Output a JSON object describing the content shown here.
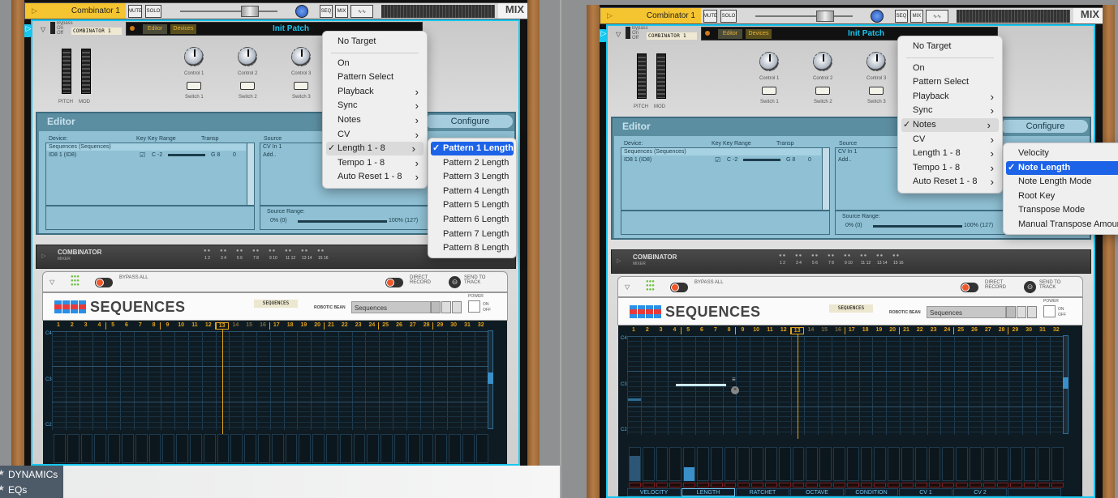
{
  "device": {
    "track_name": "Combinator 1",
    "mute": "MUTE",
    "solo": "SOLO",
    "seq": "SEQ",
    "mix": "MIX",
    "mix_label": "MIX",
    "bypass": "Bypass",
    "on": "On",
    "off": "Off",
    "combinator_label": "COMBINATOR 1",
    "editor_tab": "Editor",
    "devices_tab": "Devices",
    "patch_name": "Init Patch",
    "controls": [
      "Control 1",
      "Control 2",
      "Control 3"
    ],
    "switches": [
      "Switch 1",
      "Switch 2",
      "Switch 3"
    ],
    "pitch": "PITCH",
    "mod": "MOD",
    "editor_title": "Editor",
    "configure": "Configure",
    "col_device": "Device:",
    "col_key": "Key",
    "col_key_range": "Key Range",
    "col_transp": "Transp",
    "col_source": "Source",
    "rows": [
      {
        "name": "Sequences (Sequences)"
      },
      {
        "name": "ID8 1 (ID8)",
        "key_checked": true,
        "range_low": "C -2",
        "range_high": "G 8",
        "transp": "0"
      }
    ],
    "source_cv": "CV In 1",
    "source_add": "Add..",
    "source_range_label": "Source Range:",
    "range_min": "0% (0)",
    "range_max": "100% (127)",
    "mixer_title": "COMBINATOR",
    "mixer_sub": "MIXER",
    "mixer_channels": [
      "1 2",
      "3 4",
      "5 6",
      "7 8",
      "9 10",
      "11 12",
      "13 14",
      "15 16"
    ],
    "bypass_all": "BYPASS ALL",
    "direct_record": "DIRECT RECORD",
    "send_to_track": "SEND TO TRACK",
    "seq_title": "SEQUENCES",
    "seq_tag": "SEQUENCES",
    "brand": "ROBOTIC BEAN",
    "patch_field": "Sequences",
    "power": "POWER",
    "power_on": "ON",
    "power_off": "OFF",
    "steps": [
      "1",
      "2",
      "3",
      "4",
      "5",
      "6",
      "7",
      "8",
      "9",
      "10",
      "11",
      "12",
      "13",
      "14",
      "15",
      "16",
      "17",
      "18",
      "19",
      "20",
      "21",
      "22",
      "23",
      "24",
      "25",
      "26",
      "27",
      "28",
      "29",
      "30",
      "31",
      "32"
    ],
    "current_step": 13,
    "note_labels": [
      "C4",
      "C3",
      "C2"
    ],
    "lanes": [
      "VELOCITY",
      "LENGTH",
      "RATCHET",
      "OCTAVE",
      "CONDITION",
      "CV 1",
      "CV 2",
      ""
    ],
    "active_lane": "LENGTH",
    "colors": {
      "accent": "#16c7ef",
      "track": "#f5c531",
      "menu_selected": "#1d63e8",
      "editor": "#5c8ea2"
    }
  },
  "panels": [
    {
      "menu": [
        {
          "label": "No Target"
        },
        {
          "label": "On"
        },
        {
          "label": "Pattern Select"
        },
        {
          "label": "Playback",
          "submenu": true
        },
        {
          "label": "Sync",
          "submenu": true
        },
        {
          "label": "Notes",
          "submenu": true
        },
        {
          "label": "CV",
          "submenu": true
        },
        {
          "label": "Length 1 - 8",
          "submenu": true,
          "checked": true
        },
        {
          "label": "Tempo 1 - 8",
          "submenu": true
        },
        {
          "label": "Auto Reset 1 - 8",
          "submenu": true
        }
      ],
      "submenu": [
        {
          "label": "Pattern 1 Length",
          "checked": true
        },
        {
          "label": "Pattern 2 Length"
        },
        {
          "label": "Pattern 3 Length"
        },
        {
          "label": "Pattern 4 Length"
        },
        {
          "label": "Pattern 5 Length"
        },
        {
          "label": "Pattern 6 Length"
        },
        {
          "label": "Pattern 7 Length"
        },
        {
          "label": "Pattern 8 Length"
        }
      ]
    },
    {
      "menu": [
        {
          "label": "No Target"
        },
        {
          "label": "On"
        },
        {
          "label": "Pattern Select"
        },
        {
          "label": "Playback",
          "submenu": true
        },
        {
          "label": "Sync",
          "submenu": true
        },
        {
          "label": "Notes",
          "submenu": true,
          "checked": true
        },
        {
          "label": "CV",
          "submenu": true
        },
        {
          "label": "Length 1 - 8",
          "submenu": true
        },
        {
          "label": "Tempo 1 - 8",
          "submenu": true
        },
        {
          "label": "Auto Reset 1 - 8",
          "submenu": true
        }
      ],
      "submenu": [
        {
          "label": "Velocity"
        },
        {
          "label": "Note Length",
          "checked": true
        },
        {
          "label": "Note Length Mode"
        },
        {
          "label": "Root Key"
        },
        {
          "label": "Transpose Mode"
        },
        {
          "label": "Manual Transpose Amount"
        }
      ],
      "lane_values": {
        "velocity_step1": 0.75,
        "length_step5": 0.4
      }
    }
  ],
  "browser": {
    "items": [
      {
        "label": "DYNAMICs",
        "icon": "star-icon"
      },
      {
        "label": "EQs",
        "icon": "star-icon"
      }
    ]
  },
  "symbols": {
    "chevron": "›",
    "check": "✓",
    "play": "▷",
    "collapse": "▽",
    "star": "★"
  }
}
